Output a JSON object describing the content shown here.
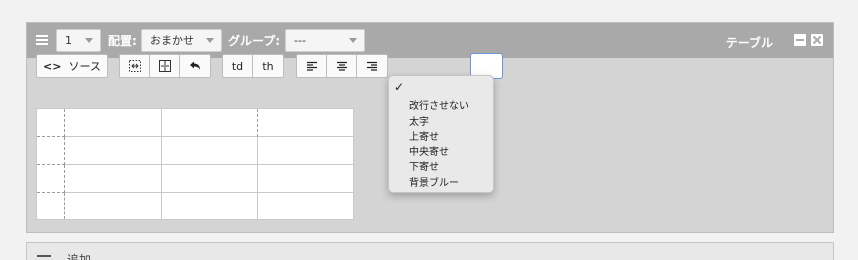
{
  "header": {
    "count_value": "1",
    "placement_label": "配置:",
    "placement_value": "おまかせ",
    "group_label": "グループ:",
    "group_value": "---",
    "title": "テーブル"
  },
  "toolbar": {
    "source_label": "ソース",
    "source_glyph": "<>",
    "td_label": "td",
    "th_label": "th"
  },
  "dropdown": {
    "checkmark": "✓",
    "items": [
      "改行させない",
      "太字",
      "上寄せ",
      "中央寄せ",
      "下寄せ",
      "背景ブルー"
    ]
  },
  "add_panel": {
    "label": "追加"
  }
}
